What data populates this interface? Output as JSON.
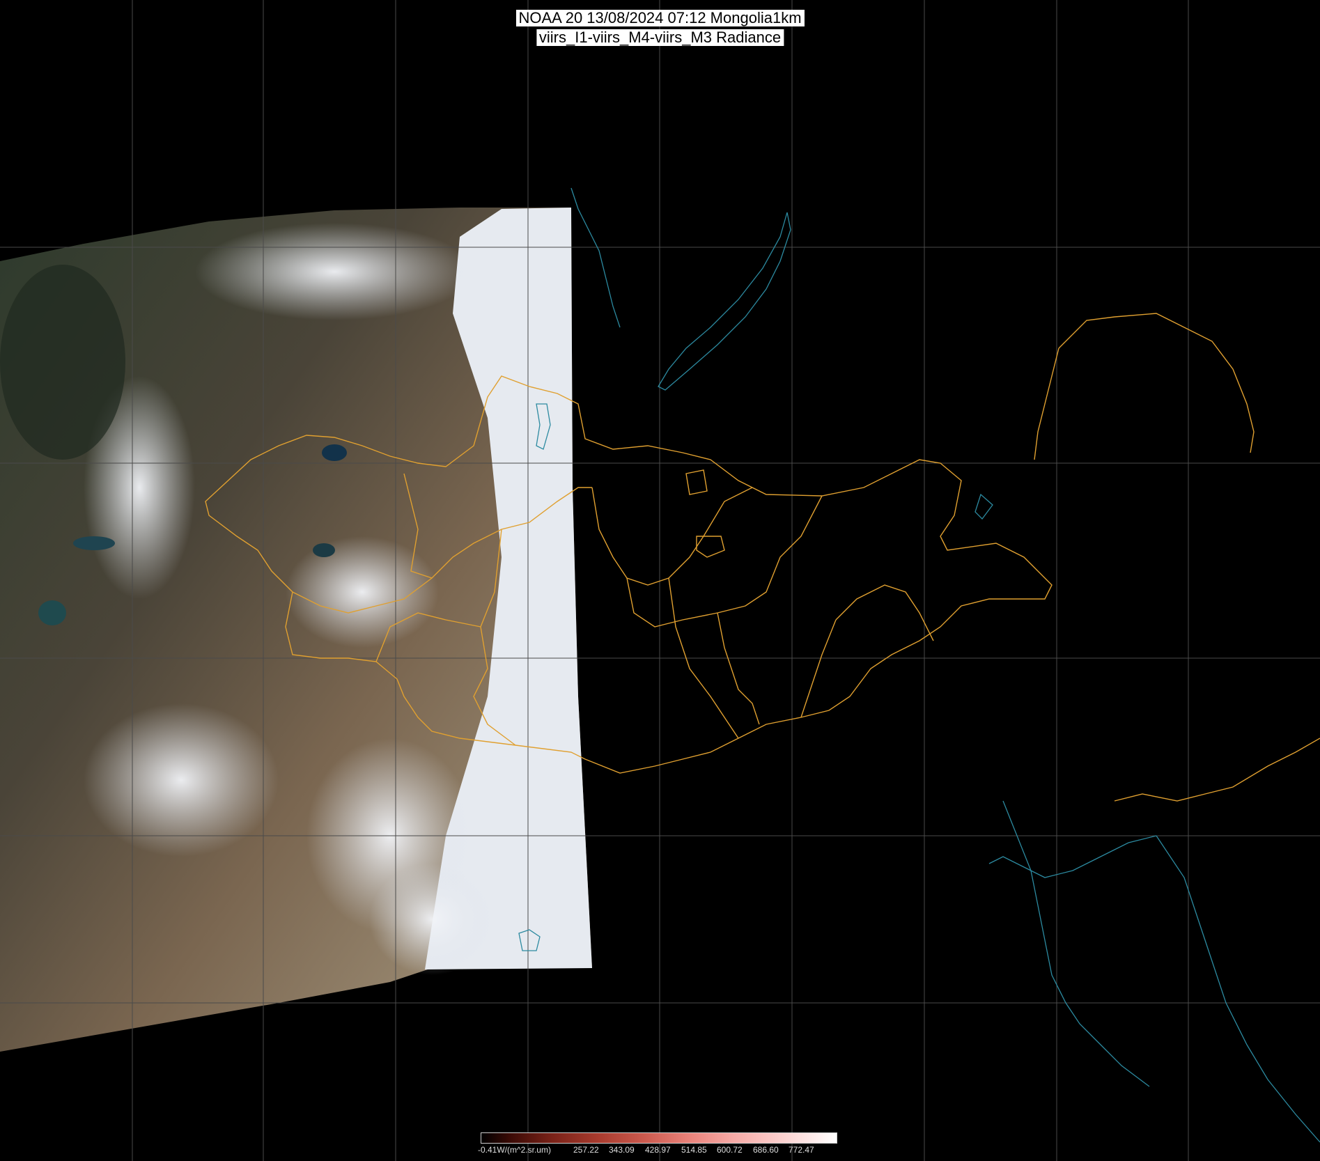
{
  "title": {
    "line1": "NOAA 20 13/08/2024 07:12 Mongolia1km",
    "line2": "viirs_I1-viirs_M4-viirs_M3 Radiance"
  },
  "legend": {
    "labels": [
      "-0.41W/(m^2.sr.um)",
      "257.22",
      "343.09",
      "428.97",
      "514.85",
      "600.72",
      "686.60",
      "772.47"
    ]
  },
  "colors": {
    "background": "#000000",
    "grid": "#555555",
    "boundaries": "#e0a030",
    "coastline": "#2c8aa0",
    "cloud": "#e8ecf2",
    "land": "#6b5a48"
  }
}
